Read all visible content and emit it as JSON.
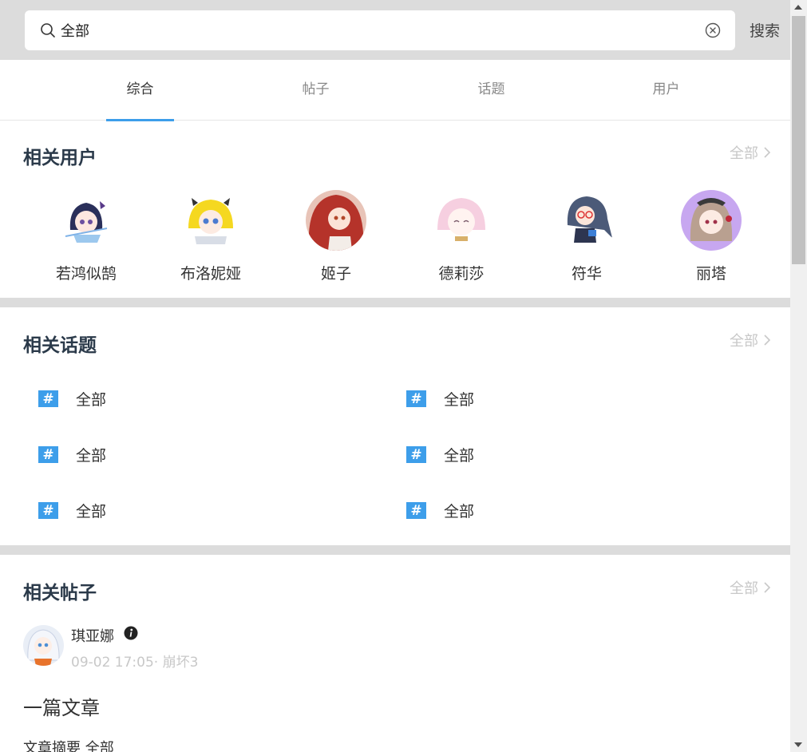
{
  "search": {
    "value": "全部",
    "button_label": "搜索"
  },
  "tabs": [
    {
      "label": "综合",
      "active": true
    },
    {
      "label": "帖子",
      "active": false
    },
    {
      "label": "话题",
      "active": false
    },
    {
      "label": "用户",
      "active": false
    }
  ],
  "users_section": {
    "title": "相关用户",
    "more_label": "全部",
    "users": [
      {
        "name": "若鸿似鹄"
      },
      {
        "name": "布洛妮娅"
      },
      {
        "name": "姬子"
      },
      {
        "name": "德莉莎"
      },
      {
        "name": "符华"
      },
      {
        "name": "丽塔"
      }
    ]
  },
  "topics_section": {
    "title": "相关话题",
    "more_label": "全部",
    "topics": [
      {
        "label": "全部"
      },
      {
        "label": "全部"
      },
      {
        "label": "全部"
      },
      {
        "label": "全部"
      },
      {
        "label": "全部"
      },
      {
        "label": "全部"
      }
    ]
  },
  "posts_section": {
    "title": "相关帖子",
    "more_label": "全部",
    "post": {
      "author": "琪亚娜",
      "meta": "09-02 17:05· 崩坏3",
      "title": "一篇文章",
      "summary": "文章摘要 全部"
    }
  },
  "colors": {
    "accent": "#3d9eea",
    "divider": "#dcdcdc",
    "muted": "#c8c8c8",
    "title": "#2b3a4a"
  }
}
